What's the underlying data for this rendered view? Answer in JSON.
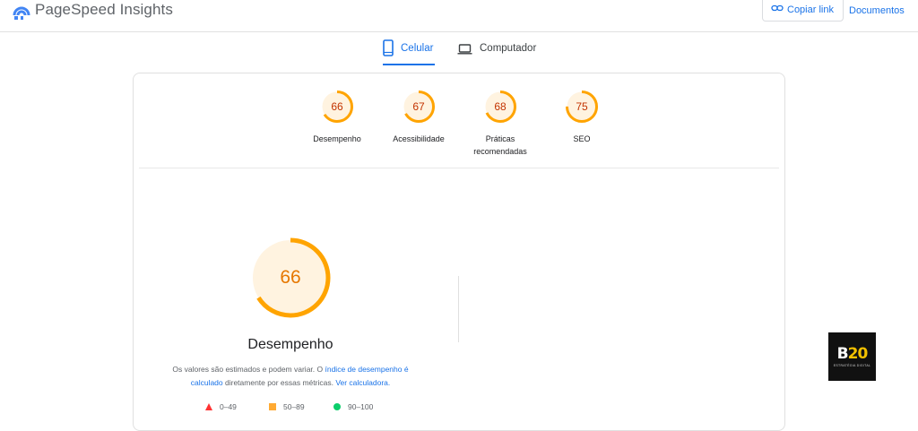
{
  "header": {
    "app_title": "PageSpeed Insights",
    "copy_link_label": "Copiar link",
    "docs_label": "Documentos"
  },
  "tabs": [
    {
      "label": "Celular",
      "icon": "smartphone-icon",
      "active": true
    },
    {
      "label": "Computador",
      "icon": "laptop-icon",
      "active": false
    }
  ],
  "scores": [
    {
      "value": "66",
      "label": "Desempenho",
      "fraction": 0.66
    },
    {
      "value": "67",
      "label": "Acessibilidade",
      "fraction": 0.67
    },
    {
      "value": "68",
      "label": "Práticas recomendadas",
      "fraction": 0.68
    },
    {
      "value": "75",
      "label": "SEO",
      "fraction": 0.75
    }
  ],
  "main_score": {
    "value": "66",
    "fraction": 0.66,
    "title": "Desempenho",
    "desc_part1": "Os valores são estimados e podem variar. O ",
    "desc_link1": "índice de desempenho é calculado",
    "desc_part2": " diretamente por essas métricas. ",
    "desc_link2": "Ver calculadora."
  },
  "legend": [
    {
      "range": "0–49",
      "color": "#ff3333",
      "shape": "triangle"
    },
    {
      "range": "50–89",
      "color": "#ffaa33",
      "shape": "square"
    },
    {
      "range": "90–100",
      "color": "#0cce6b",
      "shape": "circle"
    }
  ],
  "colors": {
    "accent": "#1a73e8",
    "average": "#ffa400",
    "average_fill": "#fff3e0",
    "average_text": "#c33300"
  },
  "badge": {
    "text_b": "B",
    "text_20": "20",
    "subtitle": "ESTRATÉGIA DIGITAL"
  }
}
